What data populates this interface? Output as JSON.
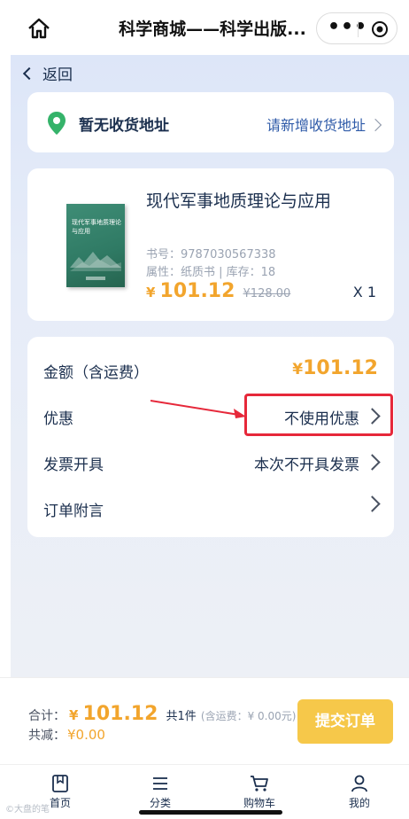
{
  "header": {
    "title": "科学商城——科学出版...",
    "icons": {
      "home": "home-icon",
      "more": "more-icon",
      "close": "target-icon"
    }
  },
  "nav": {
    "back_label": "返回"
  },
  "address": {
    "status": "暂无收货地址",
    "add_link": "请新增收货地址",
    "icon": "location-pin-icon",
    "icon_color": "#35b36a"
  },
  "product": {
    "title": "现代军事地质理论与应用",
    "cover_title": "现代军事地质理论与应用",
    "isbn_label": "书号：9787030567338",
    "attributes": "属性：纸质书 | 库存：18",
    "currency": "¥",
    "price": "101.12",
    "original_price": "¥128.00",
    "quantity": "X 1"
  },
  "summary": {
    "rows": [
      {
        "label": "金额（含运费）",
        "value": "101.12",
        "currency": "¥"
      },
      {
        "label": "优惠",
        "value": "不使用优惠"
      },
      {
        "label": "发票开具",
        "value": "本次不开具发票"
      },
      {
        "label": "订单附言",
        "value": ""
      }
    ]
  },
  "footer": {
    "total_label": "合计：",
    "currency": "¥",
    "total": "101.12",
    "count": "共1件",
    "shipping": "(含运费：¥ 0.00元)",
    "discount_label": "共减：",
    "discount": "¥0.00",
    "submit_label": "提交订单"
  },
  "tabs": [
    {
      "label": "首页",
      "icon": "bookmark-icon"
    },
    {
      "label": "分类",
      "icon": "menu-icon"
    },
    {
      "label": "购物车",
      "icon": "cart-icon"
    },
    {
      "label": "我的",
      "icon": "user-icon"
    }
  ],
  "watermark": "©大盘的笔",
  "colors": {
    "accent": "#f2a52d",
    "link": "#2e5aa8",
    "text": "#1b2f4e",
    "highlight": "#e6283a",
    "submit": "#f6c84a"
  }
}
